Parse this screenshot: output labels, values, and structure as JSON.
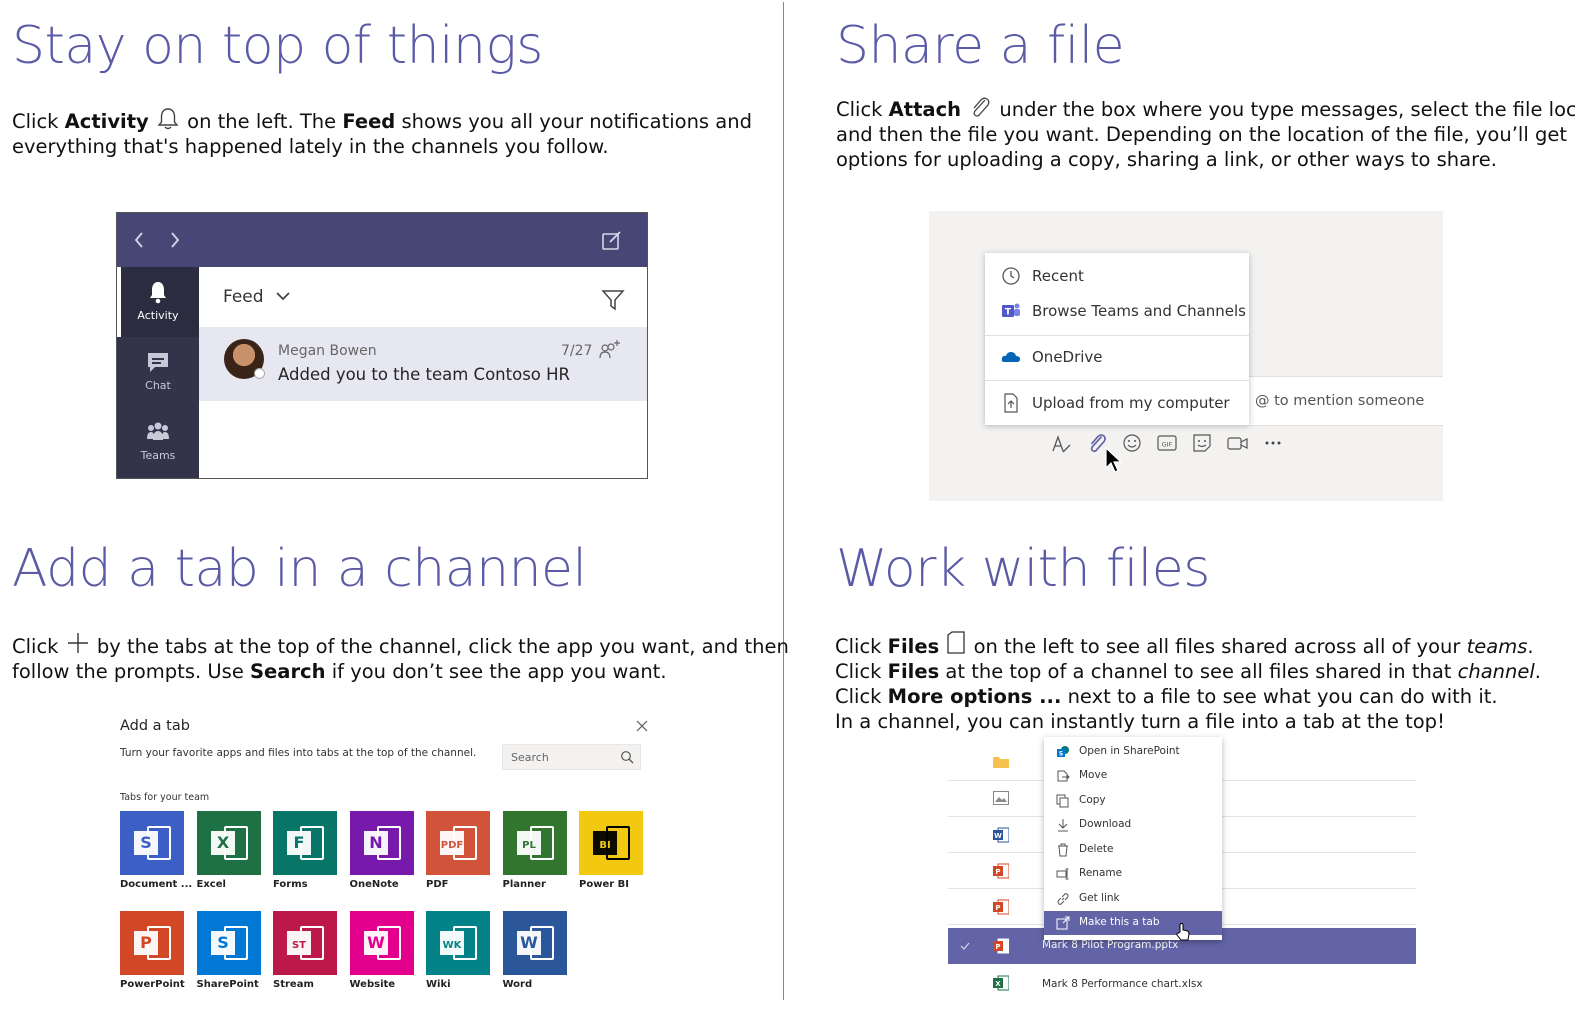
{
  "sections": {
    "top_left": {
      "heading": "Stay on top of things",
      "p1_a": "Click ",
      "p1_b": "Activity",
      "p1_c": " on the left. The ",
      "p1_d": "Feed",
      "p1_e": " shows you all your notifications and",
      "p2": "everything that's happened lately in the channels you follow."
    },
    "top_right": {
      "heading": "Share a file",
      "p1_a": "Click ",
      "p1_b": "Attach",
      "p1_c": " under the box where you type messages, select the file location",
      "p2": "and then the file you want. Depending on the location of the file, you’ll get",
      "p3": "options for uploading a copy, sharing a link, or other ways to share."
    },
    "bottom_left": {
      "heading": "Add a tab in a channel",
      "p1_a": "Click ",
      "p1_b": " by the tabs at the top of the channel, click the app you want, and then",
      "p2_a": "follow the prompts. Use ",
      "p2_b": "Search",
      "p2_c": " if you don’t see the app you want."
    },
    "bottom_right": {
      "heading": "Work with files",
      "l1_a": "Click ",
      "l1_b": "Files",
      "l1_c": " on the left to see all files shared across all of your ",
      "l1_d": "teams",
      "l1_e": ".",
      "l2_a": "Click ",
      "l2_b": "Files",
      "l2_c": " at the top of a channel to see all files shared in that ",
      "l2_d": "channel",
      "l2_e": ".",
      "l3_a": "Click ",
      "l3_b": "More options ...",
      "l3_c": " next to a file to see what you can do with it.",
      "l4": "In a channel, you can instantly turn a file into a tab at the top!"
    }
  },
  "feed_mock": {
    "rail": [
      {
        "label": "Activity",
        "icon": "bell-icon"
      },
      {
        "label": "Chat",
        "icon": "chat-icon"
      },
      {
        "label": "Teams",
        "icon": "teams-icon"
      }
    ],
    "header_label": "Feed",
    "item": {
      "name": "Megan Bowen",
      "message": "Added you to the team Contoso HR",
      "date": "7/27"
    }
  },
  "attach_mock": {
    "menu": [
      {
        "label": "Recent",
        "icon": "clock-icon"
      },
      {
        "label": "Browse Teams and Channels",
        "icon": "teams-logo-icon"
      },
      {
        "label": "OneDrive",
        "icon": "onedrive-icon"
      },
      {
        "label": "Upload from my computer",
        "icon": "upload-icon"
      }
    ],
    "compose_hint": "@ to mention someone"
  },
  "tab_mock": {
    "title": "Add a tab",
    "subtitle": "Turn your favorite apps and files into tabs at the top of the channel.",
    "search_placeholder": "Search",
    "section_label": "Tabs for your team",
    "apps": [
      {
        "label": "Document ...",
        "color": "#3b5fc4",
        "glyph": "S"
      },
      {
        "label": "Excel",
        "color": "#1e7145",
        "glyph": "X"
      },
      {
        "label": "Forms",
        "color": "#077568",
        "glyph": "F"
      },
      {
        "label": "OneNote",
        "color": "#7719aa",
        "glyph": "N"
      },
      {
        "label": "PDF",
        "color": "#d0533a",
        "glyph": "PDF"
      },
      {
        "label": "Planner",
        "color": "#31752f",
        "glyph": "PL"
      },
      {
        "label": "Power BI",
        "color": "#f2c811",
        "glyph": "BI"
      },
      {
        "label": "PowerPoint",
        "color": "#d24726",
        "glyph": "P"
      },
      {
        "label": "SharePoint",
        "color": "#0078d4",
        "glyph": "S"
      },
      {
        "label": "Stream",
        "color": "#bc1948",
        "glyph": "ST"
      },
      {
        "label": "Website",
        "color": "#e3008c",
        "glyph": "W"
      },
      {
        "label": "Wiki",
        "color": "#038387",
        "glyph": "WK"
      },
      {
        "label": "Word",
        "color": "#2b579a",
        "glyph": "W"
      }
    ]
  },
  "files_mock": {
    "context_menu": [
      {
        "label": "Open in SharePoint",
        "icon": "sharepoint-icon"
      },
      {
        "label": "Move",
        "icon": "move-icon"
      },
      {
        "label": "Copy",
        "icon": "copy-icon"
      },
      {
        "label": "Download",
        "icon": "download-icon"
      },
      {
        "label": "Delete",
        "icon": "trash-icon"
      },
      {
        "label": "Rename",
        "icon": "rename-icon"
      },
      {
        "label": "Get link",
        "icon": "link-icon"
      },
      {
        "label": "Make this a tab",
        "icon": "tab-icon"
      }
    ],
    "selected_file": "Mark 8 Pilot Program.pptx",
    "last_file": "Mark 8 Performance chart.xlsx"
  },
  "colors": {
    "heading": "#5b5aa6",
    "teams_purple": "#464775",
    "teams_rail": "#33344a",
    "selected_row": "#6264a7"
  }
}
